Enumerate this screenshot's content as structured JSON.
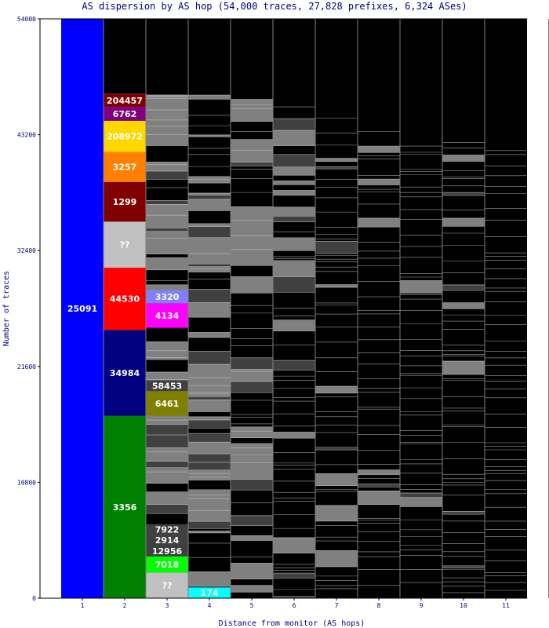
{
  "chart_data": {
    "type": "bar",
    "title": "AS dispersion by AS hop (54,000 traces, 27,828 prefixes, 6,324 ASes)",
    "xlabel": "Distance from monitor (AS hops)",
    "ylabel": "Number of traces",
    "categories": [
      "1",
      "2",
      "3",
      "4",
      "5",
      "6",
      "7",
      "8",
      "9",
      "10",
      "11"
    ],
    "ylim": [
      0,
      54000
    ],
    "y_ticks": [
      "0",
      "10800",
      "21600",
      "32400",
      "43200",
      "54000"
    ],
    "y_tick_values": [
      0,
      10800,
      21600,
      32400,
      43200,
      54000
    ],
    "grid": false,
    "column_top": 54000,
    "colored_segments": [
      {
        "hop": 1,
        "label": "25091",
        "y0": 0,
        "y1": 54000,
        "color": "#0000ff"
      },
      {
        "hop": 2,
        "label": "3356",
        "y0": 0,
        "y1": 17000,
        "color": "#008000"
      },
      {
        "hop": 2,
        "label": "34984",
        "y0": 17000,
        "y1": 25000,
        "color": "#000080"
      },
      {
        "hop": 2,
        "label": "44530",
        "y0": 25000,
        "y1": 30800,
        "color": "#ff0000"
      },
      {
        "hop": 2,
        "label": "??",
        "y0": 30800,
        "y1": 35100,
        "color": "#c0c0c0"
      },
      {
        "hop": 2,
        "label": "1299",
        "y0": 35100,
        "y1": 38800,
        "color": "#800000"
      },
      {
        "hop": 2,
        "label": "3257",
        "y0": 38800,
        "y1": 41600,
        "color": "#ff8000"
      },
      {
        "hop": 2,
        "label": "208972",
        "y0": 41600,
        "y1": 44500,
        "color": "#ffd700"
      },
      {
        "hop": 2,
        "label": "6762",
        "y0": 44500,
        "y1": 45800,
        "color": "#800080"
      },
      {
        "hop": 2,
        "label": "204457",
        "y0": 45800,
        "y1": 47000,
        "color": "#800000"
      },
      {
        "hop": 3,
        "label": "174",
        "y0": 0,
        "y1": 0,
        "color": "#808080"
      },
      {
        "hop": 3,
        "label": "??",
        "y0": 0,
        "y1": 2400,
        "color": "#c0c0c0"
      },
      {
        "hop": 3,
        "label": "7018",
        "y0": 2400,
        "y1": 3900,
        "color": "#00ff00"
      },
      {
        "hop": 3,
        "label": "12956",
        "y0": 3900,
        "y1": 4900,
        "color": "#404040"
      },
      {
        "hop": 3,
        "label": "2914",
        "y0": 4900,
        "y1": 5900,
        "color": "#404040"
      },
      {
        "hop": 3,
        "label": "7922",
        "y0": 5900,
        "y1": 6900,
        "color": "#404040"
      },
      {
        "hop": 3,
        "label": "6461",
        "y0": 17000,
        "y1": 19300,
        "color": "#808000"
      },
      {
        "hop": 3,
        "label": "58453",
        "y0": 19300,
        "y1": 20300,
        "color": "#404040"
      },
      {
        "hop": 3,
        "label": "4134",
        "y0": 25200,
        "y1": 27500,
        "color": "#ff00ff"
      },
      {
        "hop": 3,
        "label": "3320",
        "y0": 27500,
        "y1": 28700,
        "color": "#8080ff"
      },
      {
        "hop": 4,
        "label": "174",
        "y0": 0,
        "y1": 1000,
        "color": "#00ffff"
      }
    ]
  }
}
